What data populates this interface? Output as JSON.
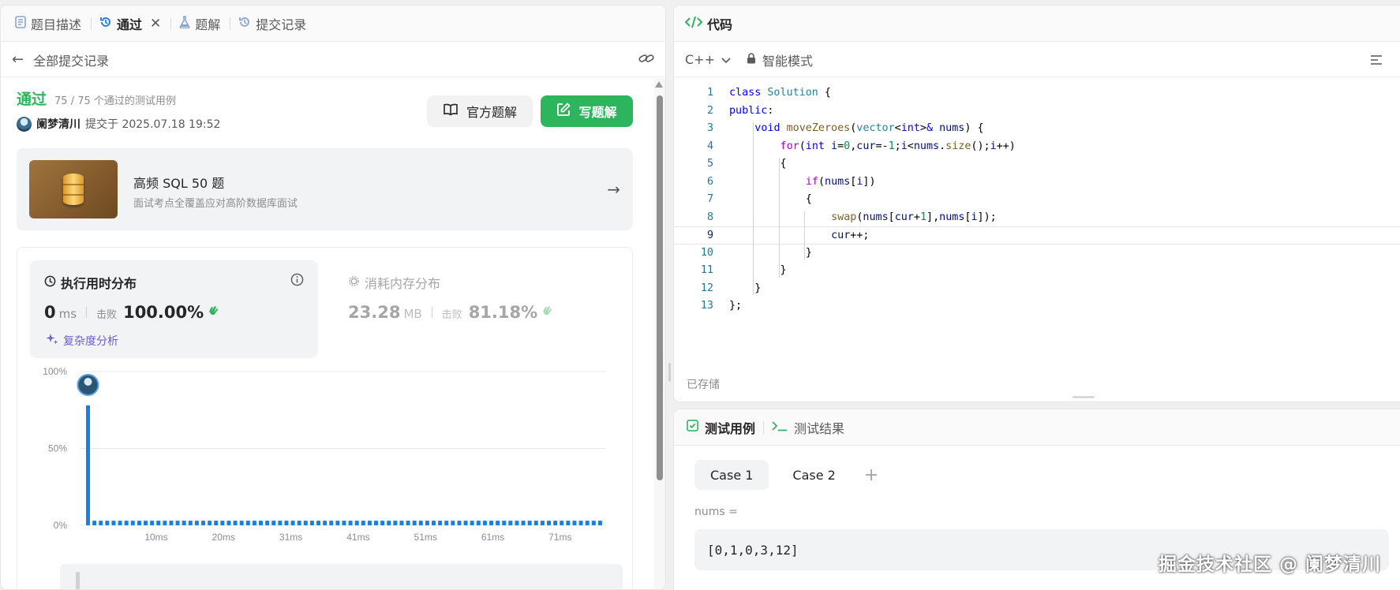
{
  "left_tabs": [
    {
      "label": "题目描述",
      "icon": "document-icon"
    },
    {
      "label": "通过",
      "icon": "history-icon"
    },
    {
      "label": "题解",
      "icon": "flask-icon"
    },
    {
      "label": "提交记录",
      "icon": "history-icon"
    }
  ],
  "back_label": "全部提交记录",
  "submission": {
    "status": "通过",
    "cases": "75 / 75 个通过的测试用例",
    "user": "阑梦清川",
    "submitted_at": "提交于 2025.07.18 19:52"
  },
  "buttons": {
    "official": "官方题解",
    "write": "写题解"
  },
  "promo": {
    "title": "高频 SQL 50 题",
    "desc": "面试考点全覆盖应对高阶数据库面试"
  },
  "runtime": {
    "title": "执行用时分布",
    "value": "0",
    "unit": "ms",
    "beat_label": "击败",
    "beat": "100.00%",
    "complexity": "复杂度分析"
  },
  "memory": {
    "title": "消耗内存分布",
    "value": "23.28",
    "unit": "MB",
    "beat_label": "击败",
    "beat": "81.18%"
  },
  "chart_data": {
    "type": "bar",
    "y_ticks": [
      "100%",
      "50%",
      "0%"
    ],
    "x_ticks": [
      "10ms",
      "20ms",
      "31ms",
      "41ms",
      "51ms",
      "61ms",
      "71ms"
    ],
    "ylim": [
      0,
      100
    ],
    "values": [
      78,
      3,
      3,
      3,
      3,
      3,
      3,
      3,
      3,
      3,
      3,
      3,
      3,
      3,
      3,
      3,
      3,
      3,
      3,
      3,
      3,
      3,
      3,
      3,
      3,
      3,
      3,
      3,
      3,
      3,
      3,
      3,
      3,
      3,
      3,
      3,
      3,
      3,
      3,
      3,
      3,
      3,
      3,
      3,
      3,
      3,
      3,
      3,
      3,
      3,
      3,
      3,
      3,
      3,
      3,
      3,
      3,
      3,
      3,
      3,
      3,
      3,
      3,
      3,
      3,
      3,
      3,
      3,
      3,
      3,
      3,
      3,
      3,
      3,
      3,
      3,
      3,
      3,
      3,
      3,
      3
    ],
    "bar_color": "#1a7fe0"
  },
  "code_panel": {
    "title": "代码",
    "language": "C++",
    "mode": "智能模式",
    "saved": "已存储",
    "current_line": 9,
    "lines": [
      {
        "n": "1",
        "indent": 0,
        "tokens": [
          {
            "t": "class ",
            "c": "kw"
          },
          {
            "t": "Solution",
            "c": "typ"
          },
          {
            "t": " {",
            "c": ""
          }
        ]
      },
      {
        "n": "2",
        "indent": 0,
        "tokens": [
          {
            "t": "public",
            "c": "kw"
          },
          {
            "t": ":",
            "c": ""
          }
        ]
      },
      {
        "n": "3",
        "indent": 1,
        "tokens": [
          {
            "t": "void ",
            "c": "kw"
          },
          {
            "t": "moveZeroes",
            "c": "fn"
          },
          {
            "t": "(",
            "c": ""
          },
          {
            "t": "vector",
            "c": "typ"
          },
          {
            "t": "<",
            "c": ""
          },
          {
            "t": "int",
            "c": "kw"
          },
          {
            "t": ">",
            "c": ""
          },
          {
            "t": "& ",
            "c": "kw"
          },
          {
            "t": "nums",
            "c": "var"
          },
          {
            "t": ") {",
            "c": ""
          }
        ]
      },
      {
        "n": "4",
        "indent": 2,
        "tokens": [
          {
            "t": "for",
            "c": "ctl"
          },
          {
            "t": "(",
            "c": ""
          },
          {
            "t": "int ",
            "c": "kw"
          },
          {
            "t": "i",
            "c": "var"
          },
          {
            "t": "=",
            "c": ""
          },
          {
            "t": "0",
            "c": "num"
          },
          {
            "t": ",",
            "c": ""
          },
          {
            "t": "cur",
            "c": "var"
          },
          {
            "t": "=-",
            "c": ""
          },
          {
            "t": "1",
            "c": "num"
          },
          {
            "t": ";",
            "c": ""
          },
          {
            "t": "i",
            "c": "var"
          },
          {
            "t": "<",
            "c": ""
          },
          {
            "t": "nums",
            "c": "var"
          },
          {
            "t": ".",
            "c": ""
          },
          {
            "t": "size",
            "c": "fn"
          },
          {
            "t": "();",
            "c": ""
          },
          {
            "t": "i",
            "c": "var"
          },
          {
            "t": "++)",
            "c": ""
          }
        ]
      },
      {
        "n": "5",
        "indent": 2,
        "tokens": [
          {
            "t": "{",
            "c": ""
          }
        ]
      },
      {
        "n": "6",
        "indent": 3,
        "tokens": [
          {
            "t": "if",
            "c": "ctl"
          },
          {
            "t": "(",
            "c": ""
          },
          {
            "t": "nums",
            "c": "var"
          },
          {
            "t": "[",
            "c": ""
          },
          {
            "t": "i",
            "c": "var"
          },
          {
            "t": "])",
            "c": ""
          }
        ]
      },
      {
        "n": "7",
        "indent": 3,
        "tokens": [
          {
            "t": "{",
            "c": ""
          }
        ]
      },
      {
        "n": "8",
        "indent": 4,
        "tokens": [
          {
            "t": "swap",
            "c": "fn"
          },
          {
            "t": "(",
            "c": ""
          },
          {
            "t": "nums",
            "c": "var"
          },
          {
            "t": "[",
            "c": ""
          },
          {
            "t": "cur",
            "c": "var"
          },
          {
            "t": "+",
            "c": ""
          },
          {
            "t": "1",
            "c": "num"
          },
          {
            "t": "],",
            "c": ""
          },
          {
            "t": "nums",
            "c": "var"
          },
          {
            "t": "[",
            "c": ""
          },
          {
            "t": "i",
            "c": "var"
          },
          {
            "t": "]);",
            "c": ""
          }
        ]
      },
      {
        "n": "9",
        "indent": 4,
        "tokens": [
          {
            "t": "cur",
            "c": "var"
          },
          {
            "t": "++;",
            "c": ""
          }
        ]
      },
      {
        "n": "10",
        "indent": 3,
        "tokens": [
          {
            "t": "}",
            "c": ""
          }
        ]
      },
      {
        "n": "11",
        "indent": 2,
        "tokens": [
          {
            "t": "}",
            "c": ""
          }
        ]
      },
      {
        "n": "12",
        "indent": 1,
        "tokens": [
          {
            "t": "}",
            "c": ""
          }
        ]
      },
      {
        "n": "13",
        "indent": 0,
        "tokens": [
          {
            "t": "};",
            "c": ""
          }
        ]
      }
    ]
  },
  "test_panel": {
    "tab_cases": "测试用例",
    "tab_results": "测试结果",
    "cases": [
      "Case 1",
      "Case 2"
    ],
    "add": "+",
    "var_label": "nums =",
    "var_value": "[0,1,0,3,12]"
  },
  "watermark": "掘金技术社区 @ 阑梦清川"
}
